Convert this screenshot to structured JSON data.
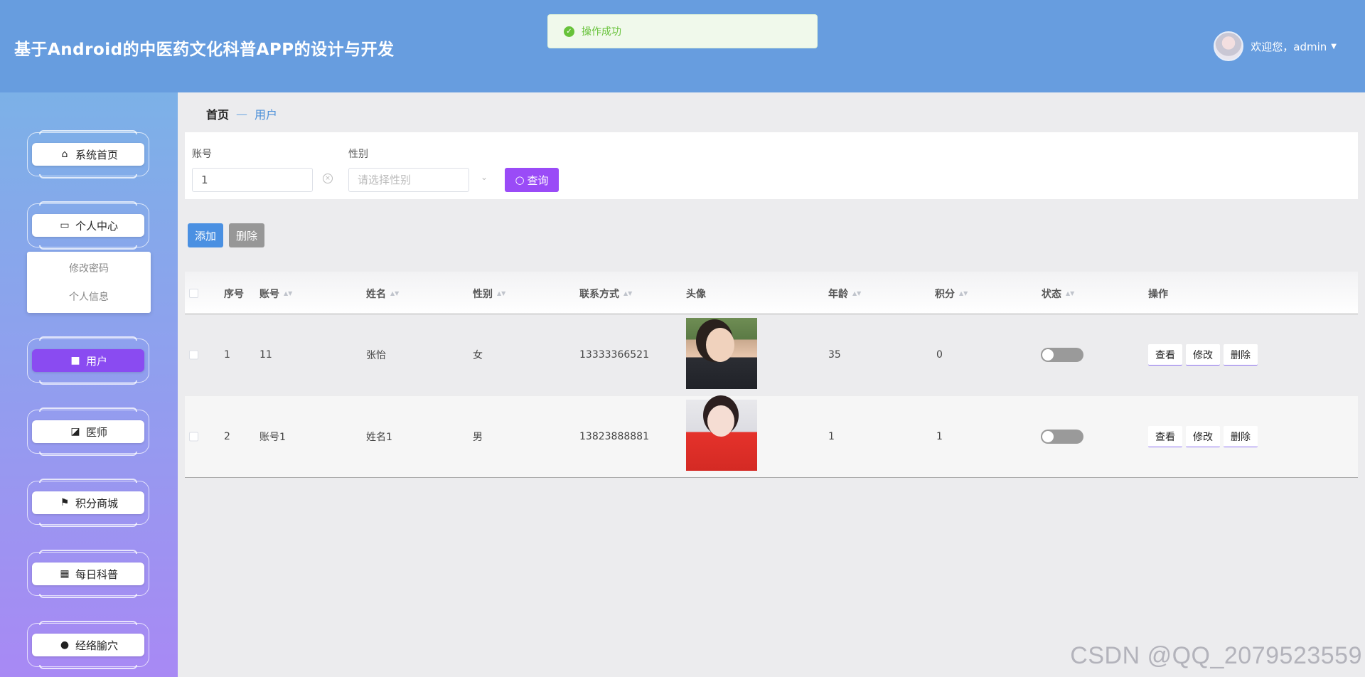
{
  "header": {
    "title": "基于Android的中医药文化科普APP的设计与开发",
    "welcome": "欢迎您，admin"
  },
  "toast": {
    "message": "操作成功"
  },
  "sidebar": {
    "items": [
      {
        "label": "系统首页",
        "icon": "home-icon"
      },
      {
        "label": "个人中心",
        "icon": "wallet-icon"
      },
      {
        "label": "用户",
        "icon": "briefcase-icon"
      },
      {
        "label": "医师",
        "icon": "chart-icon"
      },
      {
        "label": "积分商城",
        "icon": "flag-icon"
      },
      {
        "label": "每日科普",
        "icon": "grid-icon"
      },
      {
        "label": "经络腧穴",
        "icon": "user-icon"
      }
    ],
    "submenu": [
      "修改密码",
      "个人信息"
    ]
  },
  "breadcrumb": {
    "home": "首页",
    "separator": "—",
    "current": "用户"
  },
  "search": {
    "account_label": "账号",
    "account_value": "1",
    "gender_label": "性别",
    "gender_placeholder": "请选择性别",
    "query_button": "查询"
  },
  "actions": {
    "add": "添加",
    "delete": "删除"
  },
  "table": {
    "headers": {
      "index": "序号",
      "account": "账号",
      "name": "姓名",
      "gender": "性别",
      "phone": "联系方式",
      "avatar": "头像",
      "age": "年龄",
      "points": "积分",
      "status": "状态",
      "ops": "操作"
    },
    "rows": [
      {
        "index": "1",
        "account": "11",
        "name": "张怡",
        "gender": "女",
        "phone": "13333366521",
        "age": "35",
        "points": "0",
        "status": false
      },
      {
        "index": "2",
        "account": "账号1",
        "name": "姓名1",
        "gender": "男",
        "phone": "13823888881",
        "age": "1",
        "points": "1",
        "status": false
      }
    ],
    "op_labels": {
      "view": "查看",
      "edit": "修改",
      "delete": "删除"
    }
  },
  "watermark": "CSDN @QQ_2079523559",
  "colors": {
    "header": "#679ddf",
    "accent": "#9a4bf7",
    "success": "#67c23a"
  }
}
